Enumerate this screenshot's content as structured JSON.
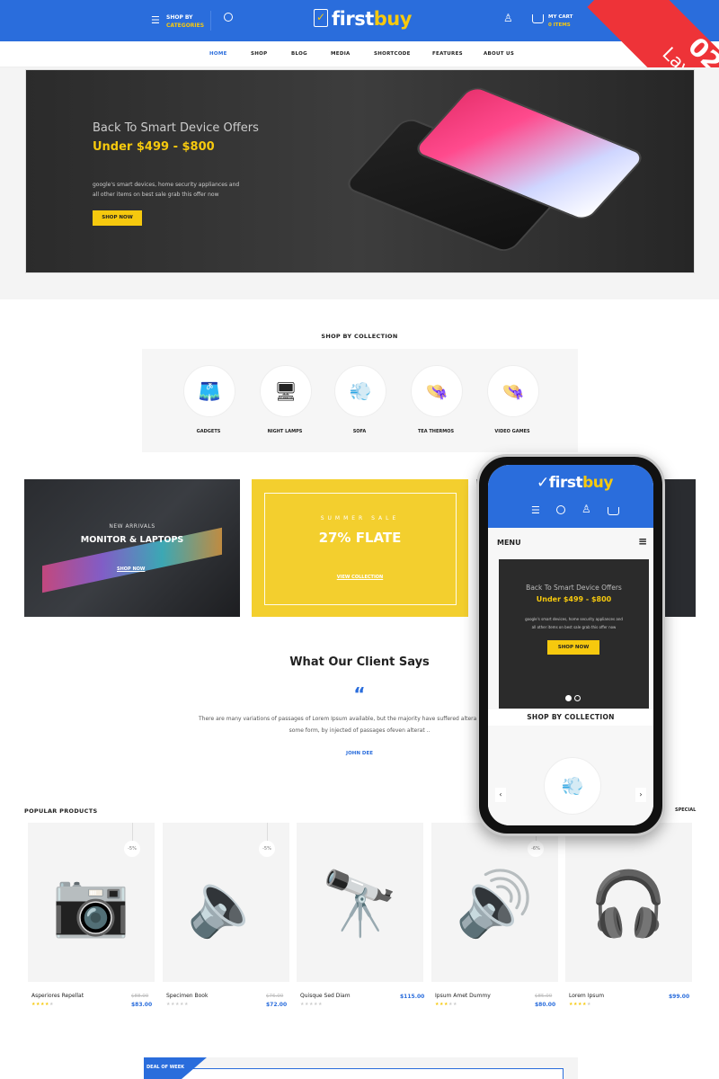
{
  "header": {
    "shop_by": "SHOP BY",
    "categories": "CATEGORIES",
    "logo_first": "first",
    "logo_second": "buy",
    "cart_label": "MY CART",
    "cart_items": "0 ITEMS"
  },
  "nav": [
    "HOME",
    "SHOP",
    "BLOG",
    "MEDIA",
    "SHORTCODE",
    "FEATURES",
    "ABOUT US"
  ],
  "ribbon": {
    "number": "02",
    "label": "Layout"
  },
  "hero": {
    "title": "Back To Smart Device Offers",
    "price": "Under $499 - $800",
    "desc1": "google's smart devices, home security appliances and",
    "desc2": "all other items on best sale grab this offer now",
    "button": "SHOP NOW"
  },
  "collection": {
    "title": "SHOP BY COLLECTION",
    "items": [
      {
        "label": "GADGETS",
        "icon": "shorts"
      },
      {
        "label": "NIGHT LAMPS",
        "icon": "monitor"
      },
      {
        "label": "SOFA",
        "icon": "hair-dryer"
      },
      {
        "label": "TEA THERMOS",
        "icon": "hat"
      },
      {
        "label": "VIDEO GAMES",
        "icon": "hat"
      }
    ]
  },
  "banners": {
    "b1_sub": "NEW ARRIVALS",
    "b1_title": "MONITOR & LAPTOPS",
    "b1_link": "SHOP NOW",
    "b2_sub": "SUMMER SALE",
    "b2_title": "27% FLATE",
    "b2_link": "VIEW COLLECTION"
  },
  "testimonial": {
    "title": "What Our Client Says",
    "text1": "There are many variations of passages of Lorem Ipsum available, but the majority have suffered alteration in",
    "text2": "some form, by injected of passages ofeven alterat ..",
    "author": "JOHN DEE"
  },
  "products": {
    "title": "POPULAR PRODUCTS",
    "special": "SPECIAL",
    "items": [
      {
        "name": "Asperiores Repellat",
        "old": "$88.00",
        "price": "$83.00",
        "badge": "-5%",
        "rating": 4
      },
      {
        "name": "Specimen Book",
        "old": "$76.00",
        "price": "$72.00",
        "badge": "-5%",
        "rating": 0
      },
      {
        "name": "Quisque Sed Diam",
        "old": "",
        "price": "$115.00",
        "badge": "",
        "rating": 0
      },
      {
        "name": "Ipsum Amet Dummy",
        "old": "$85.00",
        "price": "$80.00",
        "badge": "-6%",
        "rating": 3
      },
      {
        "name": "Lorem Ipsum",
        "old": "",
        "price": "$99.00",
        "badge": "",
        "rating": 4
      }
    ]
  },
  "deal": {
    "label": "DEAL OF WEEK"
  },
  "mobile": {
    "menu": "MENU",
    "hero_title": "Back To Smart Device Offers",
    "hero_price": "Under $499 - $800",
    "hero_desc1": "google's smart devices, home security appliances and",
    "hero_desc2": "all other items on best sale grab this offer now",
    "hero_button": "SHOP NOW",
    "collection_title": "SHOP BY COLLECTION"
  },
  "colors": {
    "primary": "#2a6ddc",
    "accent": "#f6c90e",
    "ribbon": "#ee3338"
  }
}
